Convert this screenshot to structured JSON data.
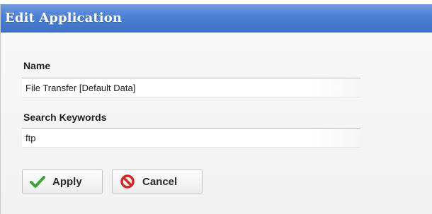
{
  "dialog": {
    "title": "Edit Application"
  },
  "form": {
    "name_label": "Name",
    "name_value": "File Transfer [Default Data]",
    "keywords_label": "Search Keywords",
    "keywords_value": "ftp"
  },
  "buttons": {
    "apply_label": "Apply",
    "apply_icon": "checkmark-icon",
    "cancel_label": "Cancel",
    "cancel_icon": "no-entry-icon"
  },
  "colors": {
    "title_bar": "#4d7fd3",
    "apply_icon": "#3aa33a",
    "cancel_icon": "#d22828"
  }
}
